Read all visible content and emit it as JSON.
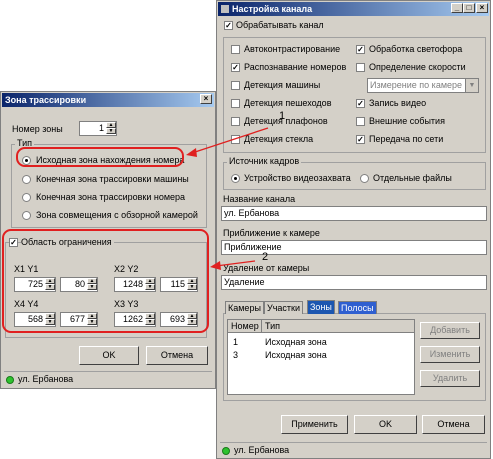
{
  "channel_window": {
    "title": "Настройка канала",
    "process_label": "Обрабатывать канал",
    "options_left": [
      {
        "label": "Автоконтрастирование",
        "checked": false,
        "enabled": true
      },
      {
        "label": "Распознавание номеров",
        "checked": true,
        "enabled": true
      },
      {
        "label": "Детекция машины",
        "checked": false,
        "enabled": true
      },
      {
        "label": "Детекция пешеходов",
        "checked": false,
        "enabled": true
      },
      {
        "label": "Детекция плафонов",
        "checked": false,
        "enabled": true
      },
      {
        "label": "Детекция стекла",
        "checked": false,
        "enabled": true
      }
    ],
    "options_right": [
      {
        "label": "Обработка светофора",
        "checked": true,
        "enabled": true
      },
      {
        "label": "Определение скорости",
        "checked": false,
        "enabled": true
      },
      {
        "label": "Запись видео",
        "checked": true,
        "enabled": true
      },
      {
        "label": "Внешние события",
        "checked": false,
        "enabled": true
      },
      {
        "label": "Передача по сети",
        "checked": true,
        "enabled": true
      }
    ],
    "speed_mode_value": "Измерение по камере",
    "frame_source_label": "Источник кадров",
    "frame_source_options": [
      "Устройство видеозахвата",
      "Отдельные файлы"
    ],
    "channel_name_label": "Название канала",
    "channel_name_value": "ул. Ербанова",
    "approach_label": "Приближение к камере",
    "approach_value": "Приближение",
    "distance_label": "Удаление от камеры",
    "distance_value": "Удаление",
    "tabs": [
      "Камеры",
      "Участки",
      "Зоны",
      "Полосы"
    ],
    "zone_table": {
      "headers": [
        "Номер",
        "Тип"
      ],
      "rows": [
        {
          "num": "1",
          "type": "Исходная зона"
        },
        {
          "num": "3",
          "type": "Исходная зона"
        }
      ]
    },
    "zone_buttons": [
      "Добавить",
      "Изменить",
      "Удалить"
    ],
    "bottom_buttons": [
      "Применить",
      "OK",
      "Отмена"
    ],
    "status_text": "ул. Ербанова"
  },
  "zone_window": {
    "title": "Зона трассировки",
    "zone_number_label": "Номер зоны",
    "zone_number_value": "1",
    "type_label": "Тип",
    "type_options": [
      "Исходная зона нахождения номера",
      "Конечная зона трассировки машины",
      "Конечная зона трассировки номера",
      "Зона совмещения с обзорной камерой"
    ],
    "region_label": "Область ограничения",
    "coord_labels": [
      "X1 Y1",
      "X2 Y2",
      "X4 Y4",
      "X3 Y3"
    ],
    "coords": {
      "x1": "725",
      "y1": "80",
      "x2": "1248",
      "y2": "115",
      "x4": "568",
      "y4": "677",
      "x3": "1262",
      "y3": "693"
    },
    "ok_label": "OK",
    "cancel_label": "Отмена",
    "status_text": "ул. Ербанова"
  },
  "annotations": {
    "arrow1": "1",
    "arrow2": "2"
  },
  "colors": {
    "accent_red": "#e02020",
    "title_blue": "#0a246a",
    "status_green": "#2ec22e"
  }
}
